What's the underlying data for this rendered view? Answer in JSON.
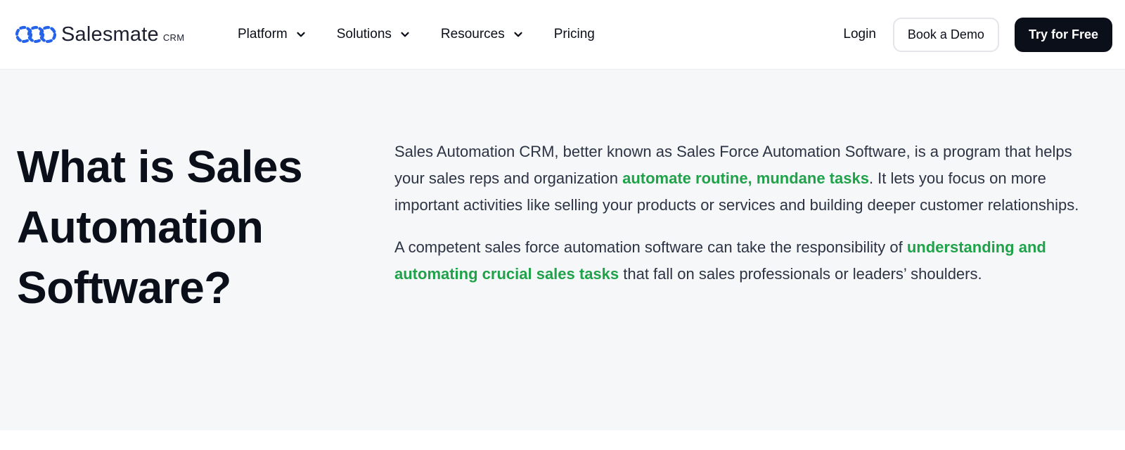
{
  "brand": {
    "name": "Salesmate",
    "suffix": "CRM",
    "color": "#2563eb"
  },
  "nav": {
    "items": [
      {
        "label": "Platform",
        "has_dropdown": true,
        "icon": "chevron-down-icon"
      },
      {
        "label": "Solutions",
        "has_dropdown": true,
        "icon": "chevron-down-icon"
      },
      {
        "label": "Resources",
        "has_dropdown": true,
        "icon": "chevron-down-icon"
      },
      {
        "label": "Pricing",
        "has_dropdown": false
      }
    ]
  },
  "actions": {
    "login": "Login",
    "book_demo": "Book a Demo",
    "try_free": "Try for Free"
  },
  "section": {
    "heading": "What is Sales Automation Software?",
    "p1": {
      "before": "Sales Automation CRM, better known as Sales Force Automation Software, is a program that helps your sales reps and organization ",
      "highlight": "automate routine, mundane tasks",
      "after": ". It lets you focus on more important activities like selling your products or services and building deeper customer relationships."
    },
    "p2": {
      "before": "A competent sales force automation software can take the responsibility of ",
      "highlight": "understanding and automating crucial sales tasks",
      "after": " that fall on sales professionals or leaders’ shoulders."
    }
  },
  "colors": {
    "background": "#f6f7f9",
    "text_dark": "#0b0f1a",
    "body_text": "#2b3344",
    "highlight_green": "#1fa24a",
    "primary_button": "#0b0f1a"
  }
}
